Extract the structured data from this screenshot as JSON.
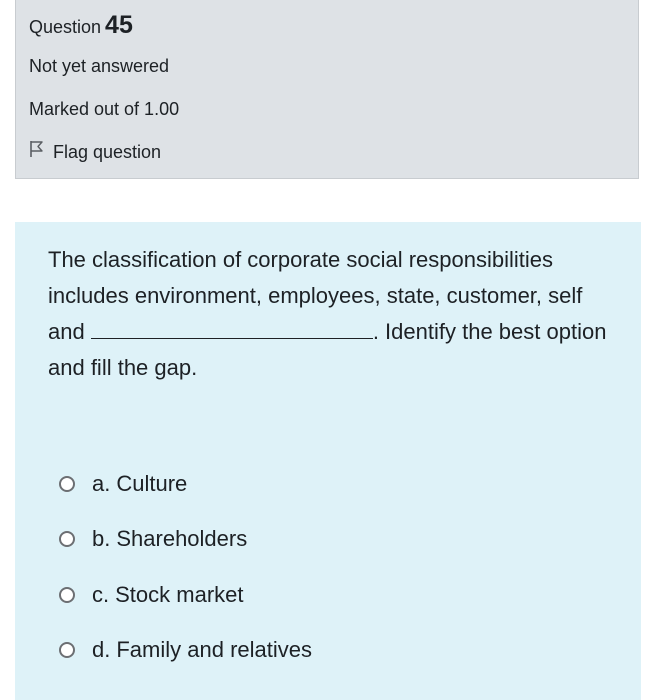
{
  "info": {
    "question_label": "Question",
    "question_number": "45",
    "state": "Not yet answered",
    "grade": "Marked out of 1.00",
    "flag_label": "Flag question",
    "flag_icon": "flag-icon"
  },
  "question": {
    "text_before_blank": "The classification of corporate social responsibilities includes environment, employees, state, customer, self and ",
    "text_after_blank": ". Identify the best option and fill the gap."
  },
  "answers": [
    {
      "number": "a.",
      "text": "Culture"
    },
    {
      "number": "b.",
      "text": "Shareholders"
    },
    {
      "number": "c.",
      "text": "Stock market"
    },
    {
      "number": "d.",
      "text": "Family and relatives"
    }
  ],
  "colors": {
    "info_bg": "#dee2e6",
    "content_bg": "#def2f8",
    "text": "#1d2125"
  }
}
